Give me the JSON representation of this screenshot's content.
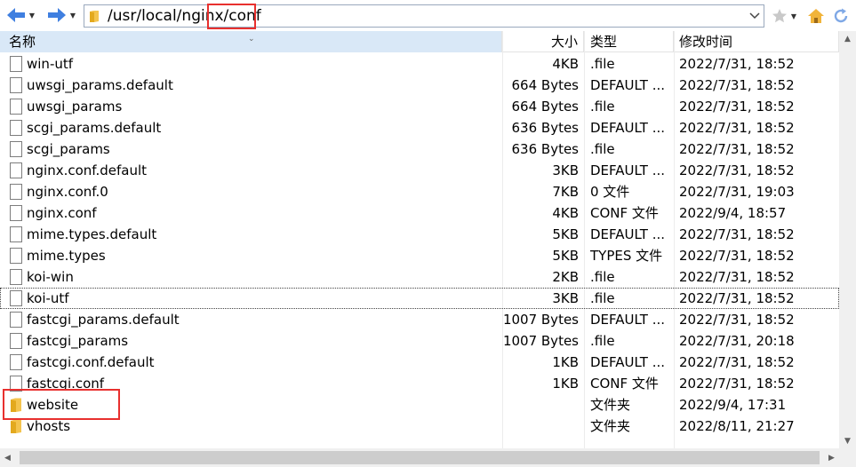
{
  "address": {
    "path": "/usr/local/nginx/conf"
  },
  "columns": {
    "name": "名称",
    "size": "大小",
    "type": "类型",
    "date": "修改时间"
  },
  "files": [
    {
      "name": "win-utf",
      "size": "4KB",
      "type": ".file",
      "date": "2022/7/31, 18:52",
      "kind": "file"
    },
    {
      "name": "uwsgi_params.default",
      "size": "664 Bytes",
      "type": "DEFAULT ...",
      "date": "2022/7/31, 18:52",
      "kind": "file"
    },
    {
      "name": "uwsgi_params",
      "size": "664 Bytes",
      "type": ".file",
      "date": "2022/7/31, 18:52",
      "kind": "file"
    },
    {
      "name": "scgi_params.default",
      "size": "636 Bytes",
      "type": "DEFAULT ...",
      "date": "2022/7/31, 18:52",
      "kind": "file"
    },
    {
      "name": "scgi_params",
      "size": "636 Bytes",
      "type": ".file",
      "date": "2022/7/31, 18:52",
      "kind": "file"
    },
    {
      "name": "nginx.conf.default",
      "size": "3KB",
      "type": "DEFAULT ...",
      "date": "2022/7/31, 18:52",
      "kind": "file"
    },
    {
      "name": "nginx.conf.0",
      "size": "7KB",
      "type": "0 文件",
      "date": "2022/7/31, 19:03",
      "kind": "file"
    },
    {
      "name": "nginx.conf",
      "size": "4KB",
      "type": "CONF 文件",
      "date": "2022/9/4, 18:57",
      "kind": "file"
    },
    {
      "name": "mime.types.default",
      "size": "5KB",
      "type": "DEFAULT ...",
      "date": "2022/7/31, 18:52",
      "kind": "file"
    },
    {
      "name": "mime.types",
      "size": "5KB",
      "type": "TYPES 文件",
      "date": "2022/7/31, 18:52",
      "kind": "file"
    },
    {
      "name": "koi-win",
      "size": "2KB",
      "type": ".file",
      "date": "2022/7/31, 18:52",
      "kind": "file"
    },
    {
      "name": "koi-utf",
      "size": "3KB",
      "type": ".file",
      "date": "2022/7/31, 18:52",
      "kind": "file"
    },
    {
      "name": "fastcgi_params.default",
      "size": "1007 Bytes",
      "type": "DEFAULT ...",
      "date": "2022/7/31, 18:52",
      "kind": "file"
    },
    {
      "name": "fastcgi_params",
      "size": "1007 Bytes",
      "type": ".file",
      "date": "2022/7/31, 20:18",
      "kind": "file"
    },
    {
      "name": "fastcgi.conf.default",
      "size": "1KB",
      "type": "DEFAULT ...",
      "date": "2022/7/31, 18:52",
      "kind": "file"
    },
    {
      "name": "fastcgi.conf",
      "size": "1KB",
      "type": "CONF 文件",
      "date": "2022/7/31, 18:52",
      "kind": "file"
    },
    {
      "name": "website",
      "size": "",
      "type": "文件夹",
      "date": "2022/9/4, 17:31",
      "kind": "folder"
    },
    {
      "name": "vhosts",
      "size": "",
      "type": "文件夹",
      "date": "2022/8/11, 21:27",
      "kind": "folder"
    }
  ],
  "colors": {
    "accent": "#2a6fdb",
    "highlight_box": "#e8302e",
    "header_selected": "#d9e8f7",
    "folder": "#f4c44e"
  }
}
